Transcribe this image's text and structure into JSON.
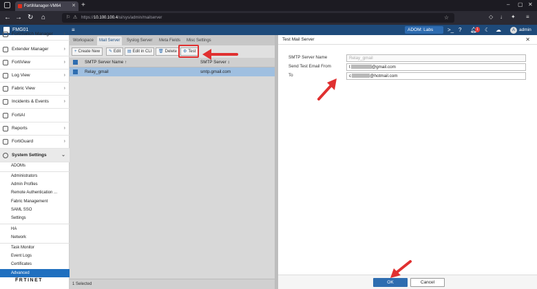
{
  "browser": {
    "tab_title": "FortiManager-VM64",
    "url_prefix": "https://",
    "url_host": "10.100.100.4",
    "url_path": "/ui/sys/admin/mailserver"
  },
  "header": {
    "app_name": "FMG01",
    "adom": "ADOM: Labs",
    "notifications": "1",
    "user_initial": "A",
    "user": "admin"
  },
  "sidebar": {
    "items": [
      {
        "label": "FortiSwitch Manager"
      },
      {
        "label": "Extender Manager"
      },
      {
        "label": "FortiView"
      },
      {
        "label": "Log View"
      },
      {
        "label": "Fabric View"
      },
      {
        "label": "Incidents & Events"
      },
      {
        "label": "FortiAI"
      },
      {
        "label": "Reports"
      },
      {
        "label": "FortiGuard"
      },
      {
        "label": "System Settings"
      }
    ],
    "sub_items": [
      {
        "label": "ADOMs"
      },
      {
        "label": "Administrators"
      },
      {
        "label": "Admin Profiles"
      },
      {
        "label": "Remote Authentication ..."
      },
      {
        "label": "Fabric Management"
      },
      {
        "label": "SAML SSO"
      },
      {
        "label": "Settings"
      },
      {
        "label": "HA"
      },
      {
        "label": "Network"
      },
      {
        "label": "Task Monitor"
      },
      {
        "label": "Event Logs"
      },
      {
        "label": "Certificates"
      },
      {
        "label": "Advanced"
      }
    ],
    "logo": "F̅RTINET"
  },
  "main": {
    "tabs": [
      "Workspace",
      "Mail Server",
      "Syslog Server",
      "Meta Fields",
      "Misc Settings"
    ],
    "toolbar": [
      "Create New",
      "Edit",
      "Edit in CLI",
      "Delete",
      "Test"
    ],
    "columns": [
      "SMTP Server Name",
      "SMTP Server"
    ],
    "sort_mark": "↑",
    "filter_mark": "↕",
    "rows": [
      {
        "name": "Relay_gmail",
        "server": "smtp.gmail.com"
      }
    ],
    "status": "1 Selected"
  },
  "dialog": {
    "title": "Test Mail Server",
    "fields": [
      {
        "label": "SMTP Server Name",
        "value": "Relay_gmail"
      },
      {
        "label": "Send Test Email From",
        "value_start": "t",
        "value_end": "@gmail.com"
      },
      {
        "label": "To",
        "value_start": "c",
        "value_end": "@hotmail.com"
      }
    ],
    "ok": "OK",
    "cancel": "Cancel"
  },
  "colors": {
    "header": "#1e4a7a",
    "selected": "#1f6fbf",
    "annotation": "#e03030"
  }
}
